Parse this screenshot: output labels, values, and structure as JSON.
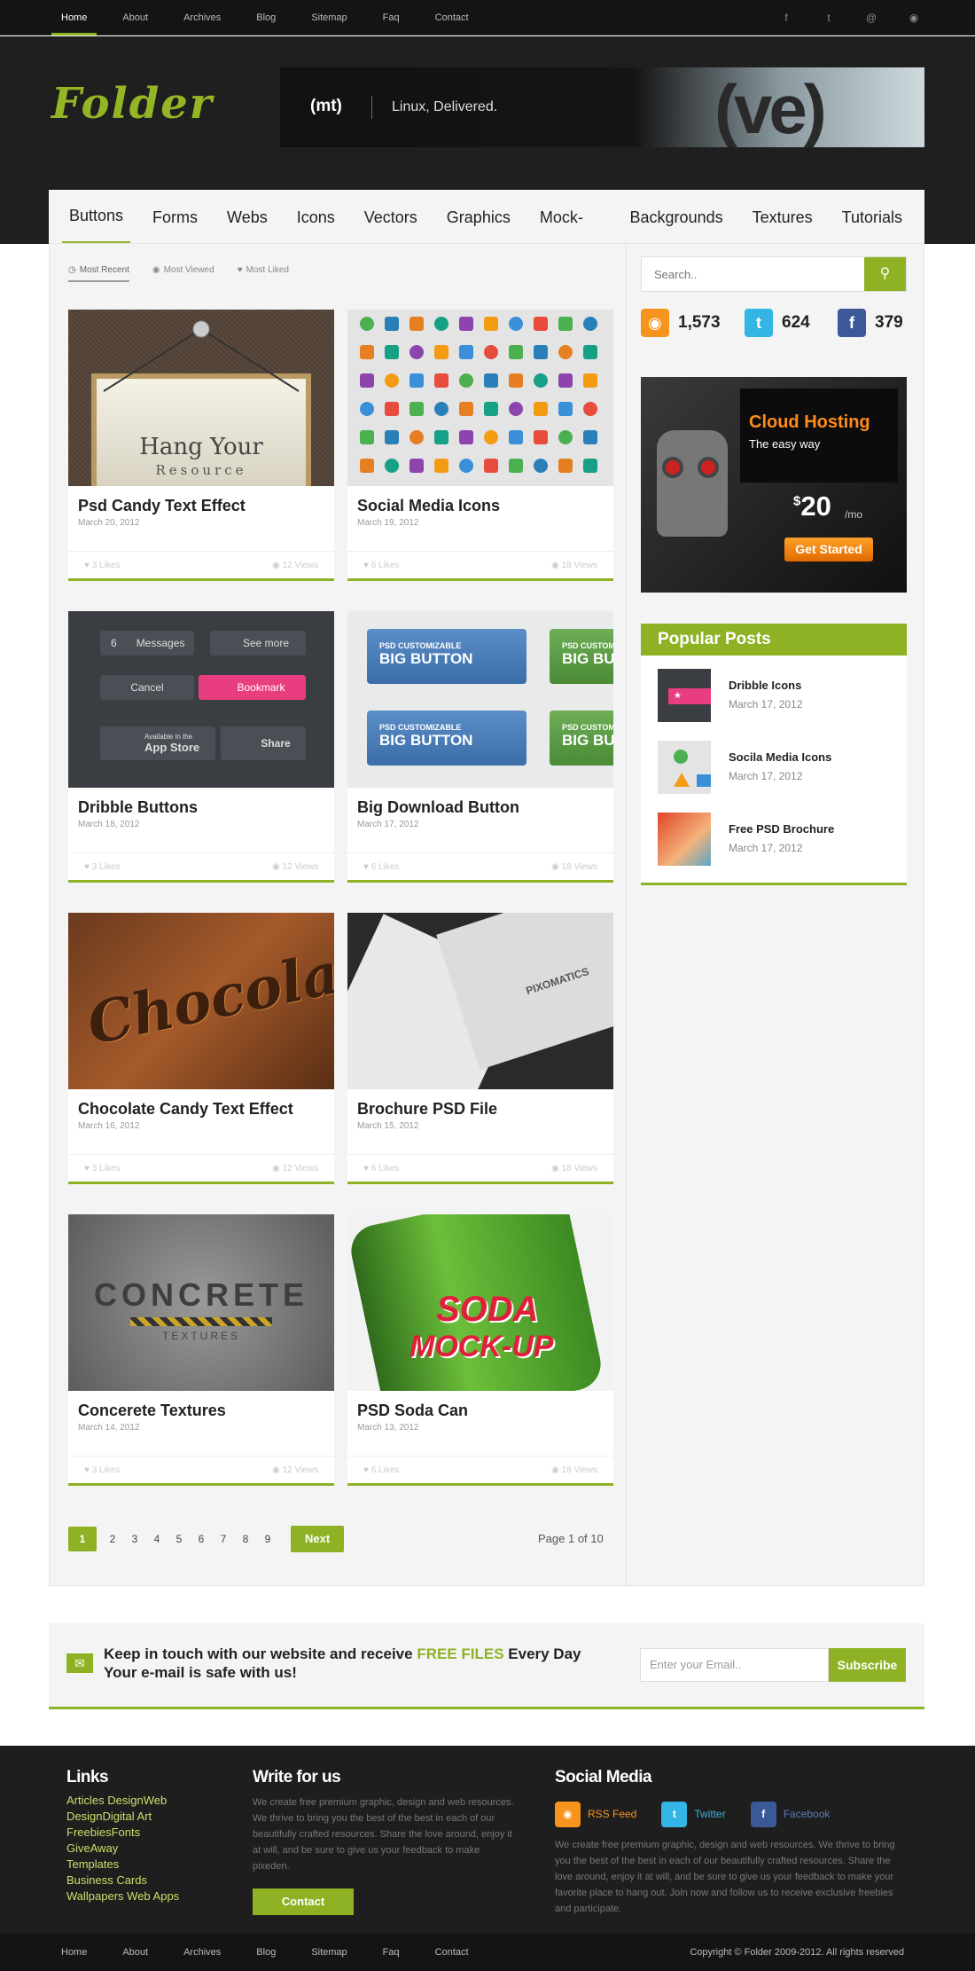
{
  "topnav": [
    "Home",
    "About",
    "Archives",
    "Blog",
    "Sitemap",
    "Faq",
    "Contact"
  ],
  "social_icons": [
    "facebook-icon",
    "twitter-icon",
    "email-icon",
    "rss-icon"
  ],
  "logo": "Folder",
  "banner": {
    "brand": "(mt)",
    "tagline": "Linux, Delivered.",
    "mark": "(ve)"
  },
  "categories": [
    "Buttons",
    "Forms",
    "Webs",
    "Icons",
    "Vectors",
    "Graphics",
    "Mock-Ups",
    "Backgrounds",
    "Textures",
    "Tutorials"
  ],
  "filters": [
    "Most Recent",
    "Most Viewed",
    "Most Liked"
  ],
  "posts": [
    {
      "title": "Psd Candy Text Effect",
      "date": "March 20, 2012",
      "likes": "3 Likes",
      "views": "12 Views",
      "thumb_text": "Hang Your",
      "thumb_sub": "Resource"
    },
    {
      "title": "Social Media Icons",
      "date": "March 19, 2012",
      "likes": "6 Likes",
      "views": "18 Views"
    },
    {
      "title": "Dribble Buttons",
      "date": "March 18, 2012",
      "likes": "3 Likes",
      "views": "12 Views",
      "thumb_labels": [
        "6",
        "Messages",
        "See more",
        "Cancel",
        "Bookmark",
        "Available in the",
        "App Store",
        "Share"
      ]
    },
    {
      "title": "Big Download Button",
      "date": "March 17, 2012",
      "likes": "6 Likes",
      "views": "18 Views",
      "thumb_small": "PSD CUSTOMIZABLE",
      "thumb_big": "BIG BUTTON"
    },
    {
      "title": "Chocolate Candy Text Effect",
      "date": "March 16, 2012",
      "likes": "3 Likes",
      "views": "12 Views",
      "thumb_text": "Chocola"
    },
    {
      "title": "Brochure PSD File",
      "date": "March 15, 2012",
      "likes": "6 Likes",
      "views": "18 Views",
      "thumb_text": "PIXOMATICS"
    },
    {
      "title": "Concerete Textures",
      "date": "March 14, 2012",
      "likes": "3 Likes",
      "views": "12 Views",
      "thumb_text": "CONCRETE",
      "thumb_sub": "TEXTURES"
    },
    {
      "title": "PSD Soda Can",
      "date": "March 13, 2012",
      "likes": "6 Likes",
      "views": "18 Views",
      "thumb_text": "SODA",
      "thumb_sub": "MOCK-UP"
    }
  ],
  "pagination": {
    "pages": [
      "1",
      "2",
      "3",
      "4",
      "5",
      "6",
      "7",
      "8",
      "9"
    ],
    "current": "1",
    "next": "Next",
    "summary": "Page 1 of 10"
  },
  "sidebar": {
    "search_placeholder": "Search..",
    "counters": [
      {
        "icon": "rss-icon",
        "value": "1,573",
        "color": "#f7941d"
      },
      {
        "icon": "twitter-icon",
        "value": "624",
        "color": "#33b5e5"
      },
      {
        "icon": "facebook-icon",
        "value": "379",
        "color": "#3b5998"
      }
    ],
    "ad": {
      "title": "Cloud Hosting",
      "subtitle": "The easy way",
      "price_symbol": "$",
      "price": "20",
      "per": "/mo",
      "cta": "Get Started"
    },
    "popular": {
      "heading": "Popular Posts",
      "items": [
        {
          "title": "Dribble Icons",
          "date": "March 17, 2012"
        },
        {
          "title": "Socila Media Icons",
          "date": "March 17, 2012"
        },
        {
          "title": "Free PSD Brochure",
          "date": "March 17, 2012"
        }
      ]
    }
  },
  "newsletter": {
    "line1_a": "Keep in touch with our website and receive ",
    "line1_hl": "FREE FILES",
    "line1_b": " Every Day",
    "line2": "Your e-mail is safe with us!",
    "placeholder": "Enter your Email..",
    "button": "Subscribe"
  },
  "footer": {
    "links_heading": "Links",
    "links": [
      "Articles DesignWeb",
      "DesignDigital Art",
      "FreebiesFonts",
      "GiveAway",
      "Templates",
      "Business Cards",
      "Wallpapers Web Apps"
    ],
    "write_heading": "Write for us",
    "write_text": "We create free premium graphic, design and web resources. We thrive to bring you the best of the best in each of our beautifully crafted resources. Share the love around, enjoy it at will, and be sure to give us your feedback to make pixeden.",
    "contact_button": "Contact",
    "social_heading": "Social Media",
    "social_links": [
      {
        "label": "RSS Feed",
        "color": "#f7941d",
        "icon": "rss-icon"
      },
      {
        "label": "Twitter",
        "color": "#33b5e5",
        "icon": "twitter-icon"
      },
      {
        "label": "Facebook",
        "color": "#3b5998",
        "icon": "facebook-icon"
      }
    ],
    "social_text": "We create free premium graphic, design and web resources. We thrive to bring you the best of the best in each of our beautifully crafted resources. Share the love around, enjoy it at will, and be sure to give us your feedback to make your favorite place to hang out. Join now and follow us to receive exclusive freebies and participate."
  },
  "bottomnav": [
    "Home",
    "About",
    "Archives",
    "Blog",
    "Sitemap",
    "Faq",
    "Contact"
  ],
  "copyright": "Copyright © Folder 2009-2012. All rights reserved",
  "colors": {
    "accent": "#8fb225",
    "dark": "#1e1e1e"
  }
}
